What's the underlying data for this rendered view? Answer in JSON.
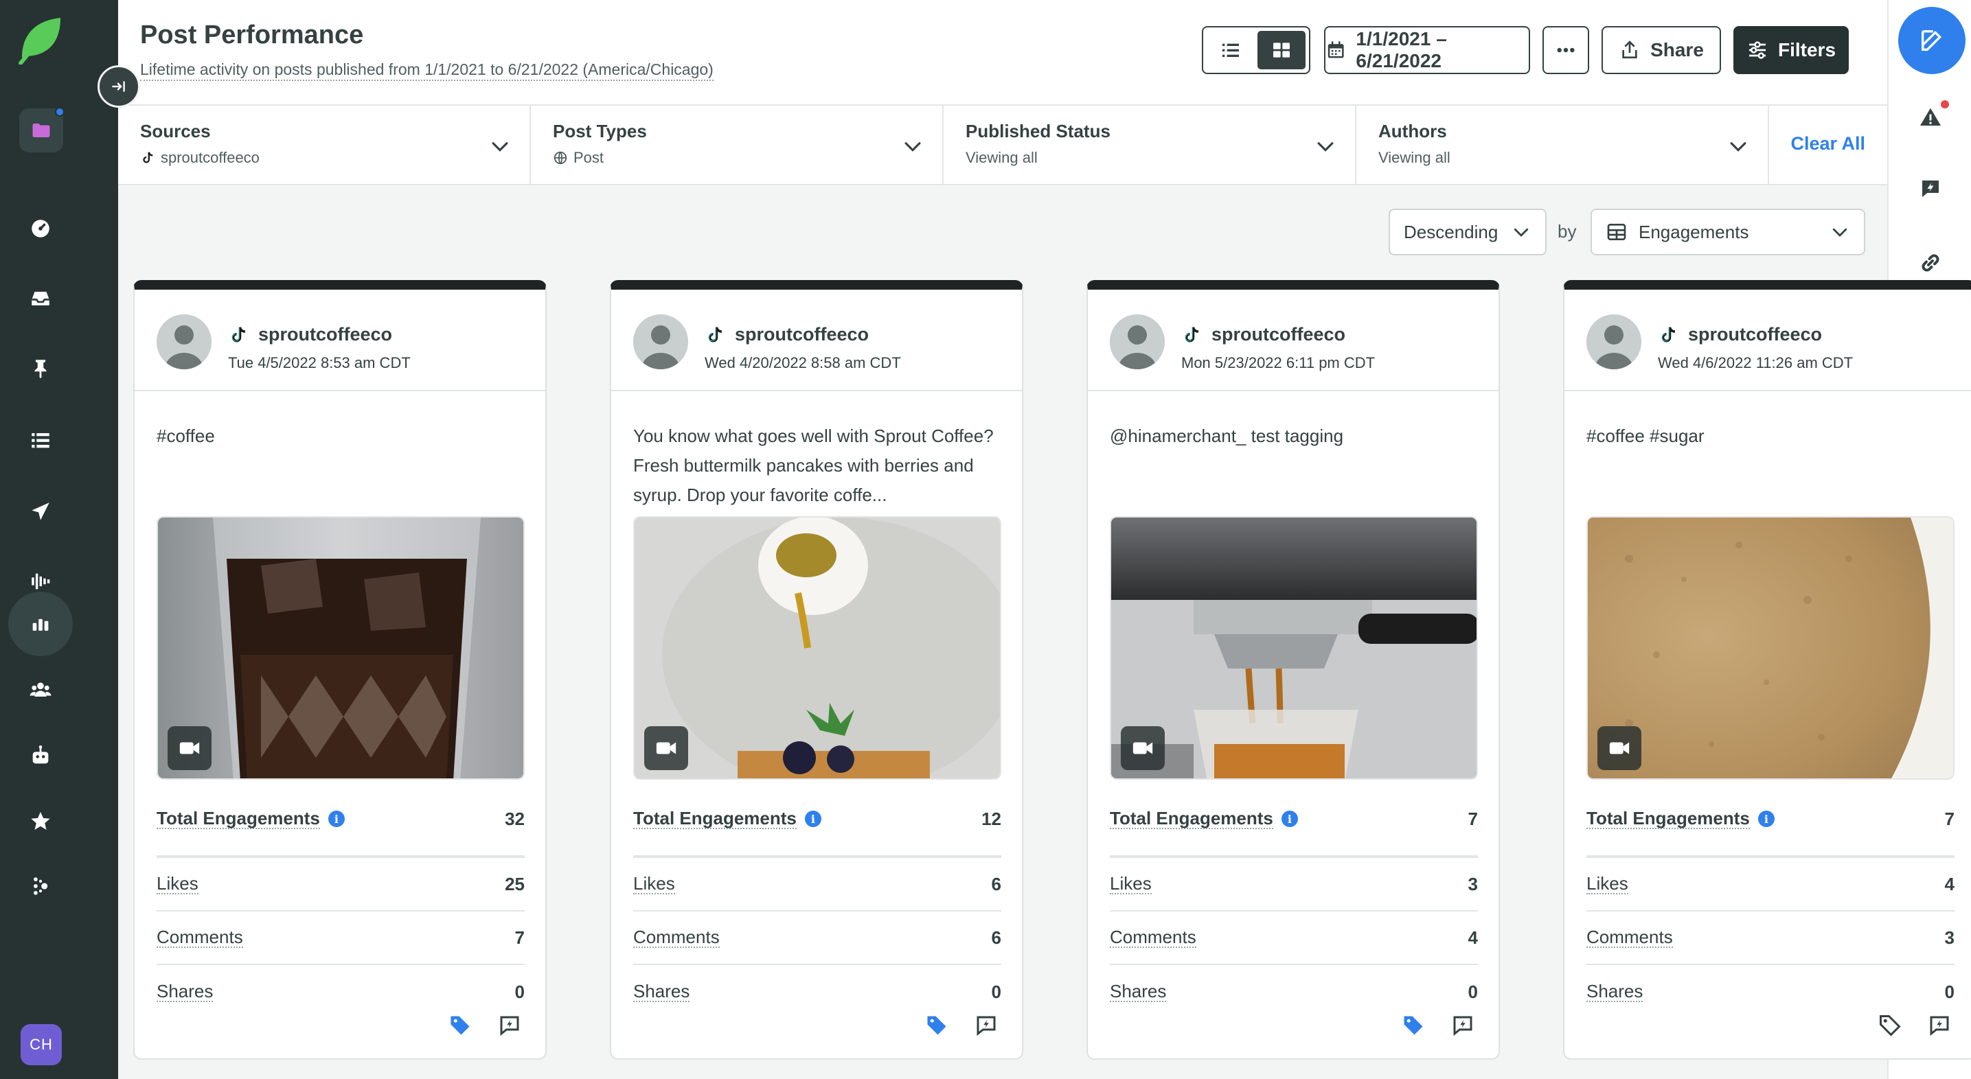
{
  "header": {
    "title": "Post Performance",
    "subtitle": "Lifetime activity on posts published from 1/1/2021 to 6/21/2022 (America/Chicago)",
    "date_range": "1/1/2021 – 6/21/2022",
    "share_label": "Share",
    "filters_label": "Filters"
  },
  "filters": {
    "sources": {
      "title": "Sources",
      "value": "sproutcoffeeco"
    },
    "post_types": {
      "title": "Post Types",
      "value": "Post"
    },
    "published_status": {
      "title": "Published Status",
      "value": "Viewing all"
    },
    "authors": {
      "title": "Authors",
      "value": "Viewing all"
    },
    "clear_all": "Clear All"
  },
  "sort": {
    "order": "Descending",
    "by_label": "by",
    "metric": "Engagements"
  },
  "user": {
    "initials": "CH"
  },
  "colors": {
    "accent": "#2f80ed",
    "nav_bg": "#273333",
    "brand_green": "#59cb59"
  },
  "posts": [
    {
      "handle": "sproutcoffeeco",
      "date": "Tue 4/5/2022 8:53 am CDT",
      "caption": "#coffee",
      "metrics": {
        "total_label": "Total Engagements",
        "total": "32",
        "likes_label": "Likes",
        "likes": "25",
        "comments_label": "Comments",
        "comments": "7",
        "shares_label": "Shares",
        "shares": "0"
      },
      "tagged": true
    },
    {
      "handle": "sproutcoffeeco",
      "date": "Wed 4/20/2022 8:58 am CDT",
      "caption": "You know what goes well with Sprout Coffee? Fresh buttermilk pancakes with berries and syrup. Drop your favorite coffe...",
      "metrics": {
        "total_label": "Total Engagements",
        "total": "12",
        "likes_label": "Likes",
        "likes": "6",
        "comments_label": "Comments",
        "comments": "6",
        "shares_label": "Shares",
        "shares": "0"
      },
      "tagged": true
    },
    {
      "handle": "sproutcoffeeco",
      "date": "Mon 5/23/2022 6:11 pm CDT",
      "caption": "@hinamerchant_ test tagging",
      "metrics": {
        "total_label": "Total Engagements",
        "total": "7",
        "likes_label": "Likes",
        "likes": "3",
        "comments_label": "Comments",
        "comments": "4",
        "shares_label": "Shares",
        "shares": "0"
      },
      "tagged": true
    },
    {
      "handle": "sproutcoffeeco",
      "date": "Wed 4/6/2022 11:26 am CDT",
      "caption": "#coffee #sugar",
      "metrics": {
        "total_label": "Total Engagements",
        "total": "7",
        "likes_label": "Likes",
        "likes": "4",
        "comments_label": "Comments",
        "comments": "3",
        "shares_label": "Shares",
        "shares": "0"
      },
      "tagged": false
    }
  ]
}
